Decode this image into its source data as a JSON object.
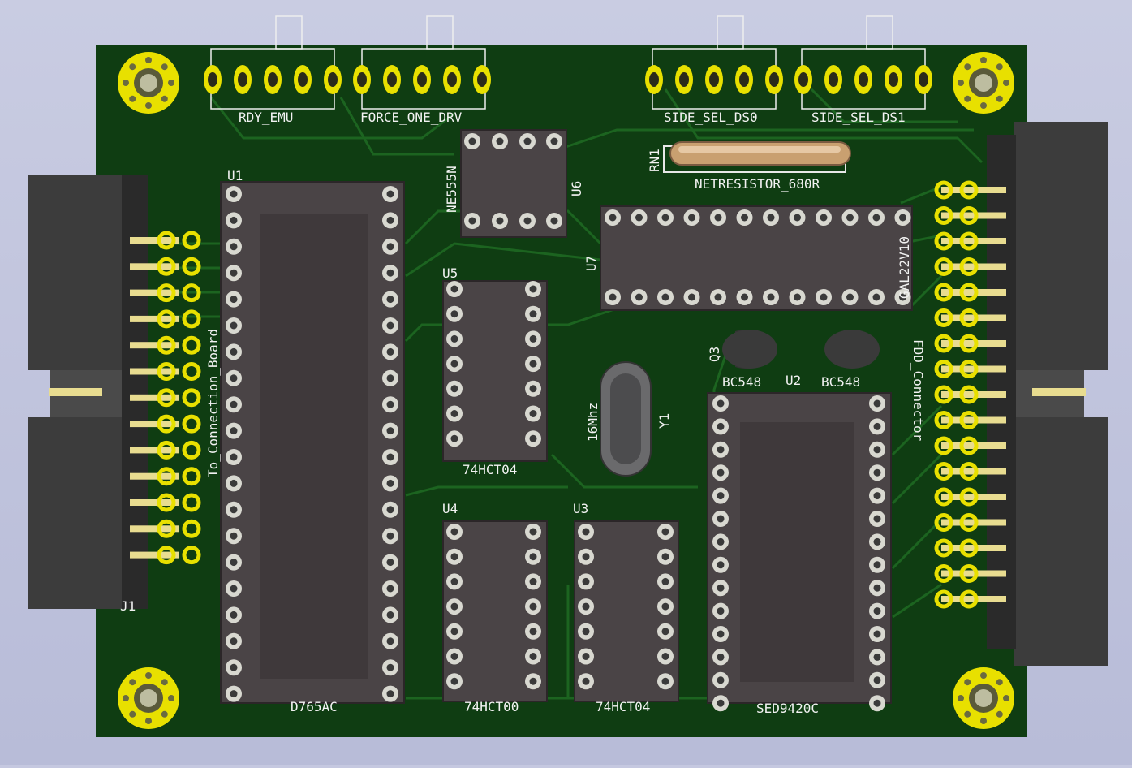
{
  "colors": {
    "background": "#c5c8e0",
    "board": "#0f3d12",
    "trace": "#1c6420",
    "socket": "#4a4446",
    "socket_outline": "#2b2628",
    "pad": "#d8d8d0",
    "pad_hole": "#3a3a3a",
    "gold": "#e8e000",
    "silk": "#f2f2f2",
    "crystal": "#5a5a5c",
    "resistor": "#c9a070"
  },
  "components": {
    "u1": {
      "ref": "U1",
      "value": "D765AC"
    },
    "u2": {
      "ref": "U2",
      "value": "SED9420C"
    },
    "u3": {
      "ref": "U3",
      "value": "74HCT04"
    },
    "u4": {
      "ref": "U4",
      "value": "74HCT00"
    },
    "u5": {
      "ref": "U5",
      "value": "74HCT04"
    },
    "u6": {
      "ref": "U6",
      "value": "NE555N"
    },
    "u7": {
      "ref": "U7",
      "value": "GAL22V10"
    },
    "rn1": {
      "ref": "RN1",
      "value": "NETRESISTOR_680R"
    },
    "q2": {
      "value": "BC548"
    },
    "q3": {
      "ref": "Q3",
      "value": "BC548"
    },
    "y1": {
      "ref": "Y1",
      "value": "16Mhz"
    },
    "j1": {
      "ref": "J1",
      "value": "To_Connection_Board"
    },
    "j2": {
      "value": "FDD_Connector"
    },
    "rdy": {
      "value": "RDY_EMU"
    },
    "force": {
      "value": "FORCE_ONE_DRV"
    },
    "ds0": {
      "value": "SIDE_SEL_DS0"
    },
    "ds1": {
      "value": "SIDE_SEL_DS1"
    }
  }
}
